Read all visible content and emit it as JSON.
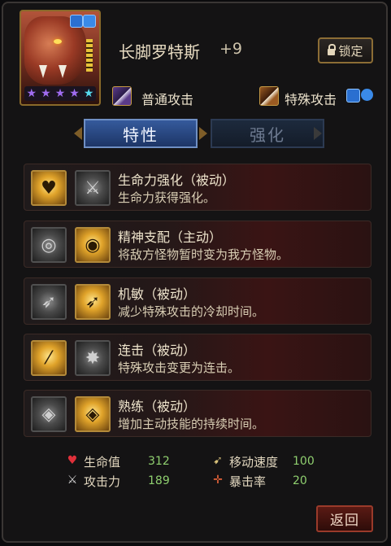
{
  "hero": {
    "name": "长脚罗特斯",
    "level": "+9",
    "stars": 5
  },
  "lock_button": {
    "label": "锁定"
  },
  "attacks": {
    "normal": "普通攻击",
    "special": "特殊攻击"
  },
  "tabs": [
    {
      "label": "特性",
      "active": true
    },
    {
      "label": "强化",
      "active": false
    }
  ],
  "skills": [
    {
      "name": "生命力强化（被动）",
      "desc": "生命力获得强化。",
      "icons": [
        "heart-aura-icon",
        "sword-cross-icon"
      ]
    },
    {
      "name": "精神支配（主动）",
      "desc": "将敌方怪物暂时变为我方怪物。",
      "icons": [
        "swirl-icon",
        "mind-eye-icon"
      ]
    },
    {
      "name": "机敏（被动）",
      "desc": "减少特殊攻击的冷却时间。",
      "icons": [
        "arrows-icon",
        "golden-arrows-icon"
      ]
    },
    {
      "name": "连击（被动）",
      "desc": "特殊攻击变更为连击。",
      "icons": [
        "slash-icon",
        "burst-icon"
      ]
    },
    {
      "name": "熟练（被动）",
      "desc": "增加主动技能的持续时间。",
      "icons": [
        "claw-eye-icon",
        "golden-eye-icon"
      ]
    }
  ],
  "stats": {
    "hp": {
      "label": "生命值",
      "value": "312"
    },
    "attack": {
      "label": "攻击力",
      "value": "189"
    },
    "move_speed": {
      "label": "移动速度",
      "value": "100"
    },
    "crit_rate": {
      "label": "暴击率",
      "value": "20"
    }
  },
  "return_button": {
    "label": "返回"
  },
  "colors": {
    "accent_gold": "#b38a3a",
    "stat_value_green": "#8fcf6f",
    "tab_active_blue": "#355a9c",
    "return_red": "#5a1a14"
  }
}
